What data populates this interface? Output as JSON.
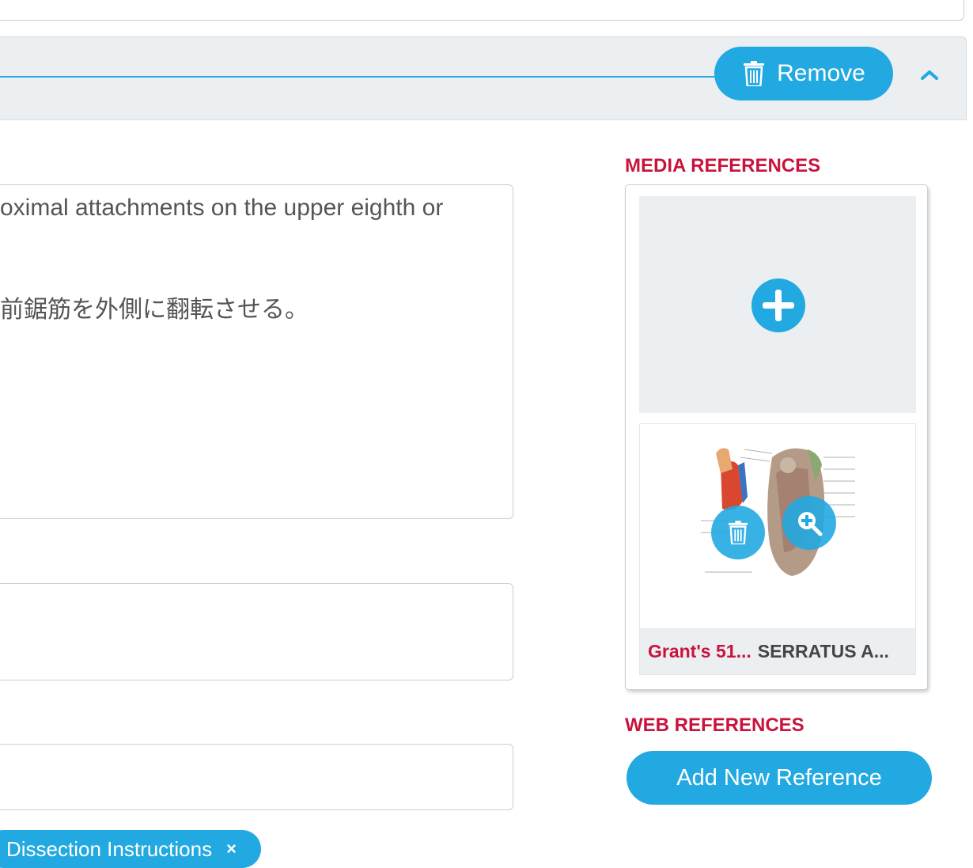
{
  "header": {
    "remove_label": "Remove"
  },
  "content": {
    "text_line_1": "oximal attachments on the upper eighth or",
    "text_line_2": "前鋸筋を外側に翻転させる。"
  },
  "tags": [
    {
      "label": "Dissection Instructions",
      "close": "×"
    }
  ],
  "media_references": {
    "title": "MEDIA REFERENCES",
    "items": [
      {
        "source": "Grant's 51...",
        "title": "SERRATUS A..."
      }
    ]
  },
  "web_references": {
    "title": "WEB REFERENCES",
    "add_label": "Add New Reference"
  },
  "icons": {
    "remove": "trash-icon",
    "collapse": "chevron-up-icon",
    "add_media": "plus-circle-icon",
    "delete_media": "trash-icon",
    "zoom_media": "zoom-in-icon"
  },
  "colors": {
    "accent": "#22a9e1",
    "heading_red": "#c8133c",
    "panel_gray": "#ebeff1"
  }
}
